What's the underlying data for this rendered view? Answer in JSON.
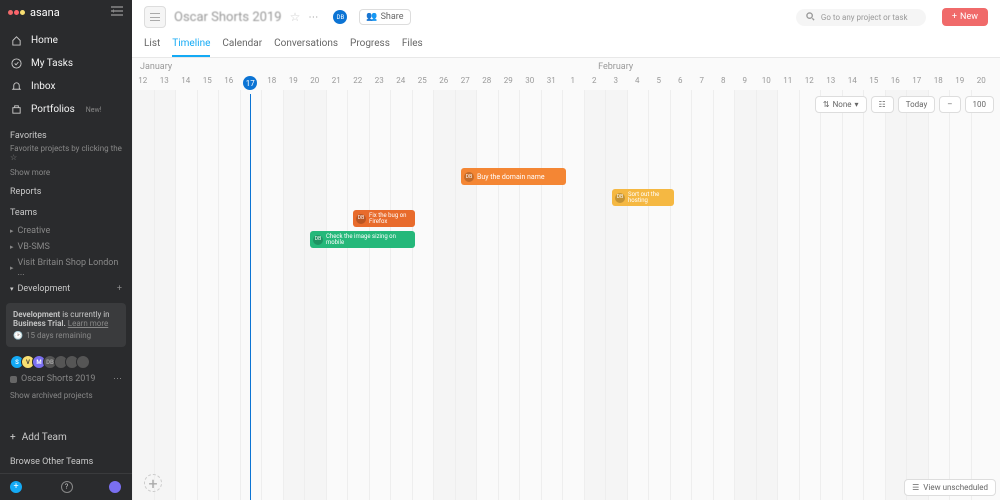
{
  "logo_text": "asana",
  "nav": {
    "home": "Home",
    "tasks": "My Tasks",
    "inbox": "Inbox",
    "portfolios": "Portfolios",
    "new_badge": "New!"
  },
  "favorites": {
    "title": "Favorites",
    "sub_prefix": "Favorite projects by clicking the",
    "show_more": "Show more"
  },
  "reports_title": "Reports",
  "teams_title": "Teams",
  "team_items": [
    "Creative",
    "VB-SMS",
    "Visit Britain Shop London ...",
    "Development"
  ],
  "trial": {
    "line1_a": "Development",
    "line1_b": " is currently in ",
    "line1_c": "Business Trial.",
    "learn": "Learn more",
    "time": "15 days remaining"
  },
  "project_name": "Oscar Shorts 2019",
  "show_archived": "Show archived projects",
  "add_team": "Add Team",
  "browse_teams": "Browse Other Teams",
  "header": {
    "project": "Oscar Shorts 2019",
    "avatar": "DB",
    "share": "Share"
  },
  "search_placeholder": "Go to any project or task",
  "new_btn": "New",
  "tabs": [
    "List",
    "Timeline",
    "Calendar",
    "Conversations",
    "Progress",
    "Files"
  ],
  "months": {
    "jan": "January",
    "feb": "February"
  },
  "days": [
    "12",
    "13",
    "14",
    "15",
    "16",
    "17",
    "18",
    "19",
    "20",
    "21",
    "22",
    "23",
    "24",
    "25",
    "26",
    "27",
    "28",
    "29",
    "30",
    "31",
    "1",
    "2",
    "3",
    "4",
    "5",
    "6",
    "7",
    "8",
    "9",
    "10",
    "11",
    "12",
    "13",
    "14",
    "15",
    "16",
    "17",
    "18",
    "19",
    "20"
  ],
  "controls": {
    "none": "None",
    "today": "Today",
    "zoom_minus": "–",
    "zoom_pct": "100"
  },
  "tasks": {
    "buy_domain": {
      "av": "DB",
      "text": "Buy the domain name"
    },
    "sort_hosting": {
      "av": "DB",
      "text": "Sort out the hosting"
    },
    "fix_bug": {
      "av": "DB",
      "text": "Fix the bug on Firefox"
    },
    "check_image": {
      "av": "DB",
      "text": "Check the image sizing on mobile"
    }
  },
  "view_unscheduled": "View unscheduled",
  "av_labels": {
    "a": "S",
    "b": "V",
    "c": "M",
    "d": "DB"
  }
}
